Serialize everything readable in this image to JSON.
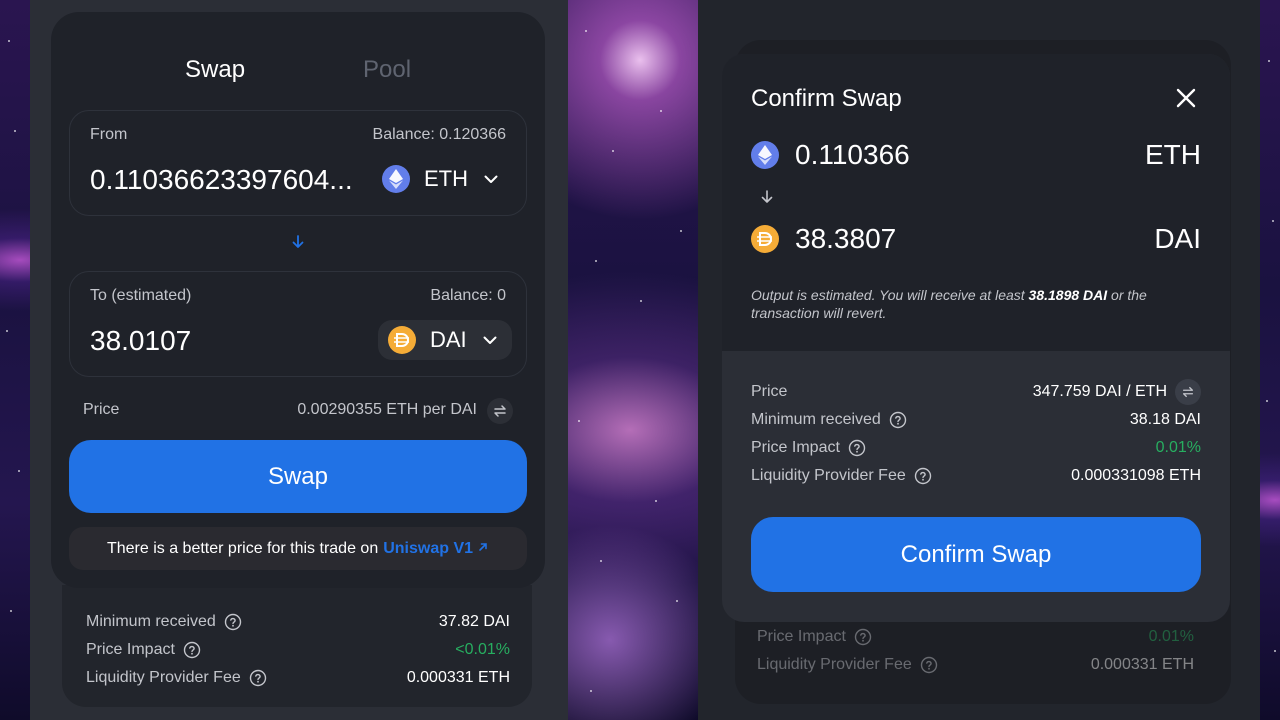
{
  "left": {
    "tabs": {
      "swap": "Swap",
      "pool": "Pool"
    },
    "from": {
      "label": "From",
      "balance": "Balance: 0.120366",
      "amount": "0.11036623397604...",
      "token": "ETH"
    },
    "to": {
      "label": "To (estimated)",
      "balance": "Balance: 0",
      "amount": "38.0107",
      "token": "DAI"
    },
    "price": {
      "label": "Price",
      "value": "0.00290355 ETH per DAI"
    },
    "swap_button": "Swap",
    "better_price": {
      "text": "There is a better price for this trade on",
      "link": "Uniswap V1"
    },
    "details": {
      "minimum_received": {
        "label": "Minimum received",
        "value": "37.82 DAI"
      },
      "price_impact": {
        "label": "Price Impact",
        "value": "<0.01%"
      },
      "lp_fee": {
        "label": "Liquidity Provider Fee",
        "value": "0.000331 ETH"
      }
    }
  },
  "right": {
    "title": "Confirm Swap",
    "from": {
      "amount": "0.110366",
      "token": "ETH"
    },
    "to": {
      "amount": "38.3807",
      "token": "DAI"
    },
    "note": {
      "before": "Output is estimated. You will receive at least ",
      "amount": "38.1898 DAI",
      "after": " or the transaction will revert."
    },
    "details": {
      "price": {
        "label": "Price",
        "value": "347.759 DAI / ETH"
      },
      "minimum_received": {
        "label": "Minimum received",
        "value": "38.18 DAI"
      },
      "price_impact": {
        "label": "Price Impact",
        "value": "0.01%"
      },
      "lp_fee": {
        "label": "Liquidity Provider Fee",
        "value": "0.000331098 ETH"
      }
    },
    "confirm_button": "Confirm Swap",
    "background_rows": {
      "price_impact": {
        "label": "Price Impact",
        "value": "0.01%"
      },
      "lp_fee": {
        "label": "Liquidity Provider Fee",
        "value": "0.000331 ETH"
      }
    }
  },
  "colors": {
    "accent": "#2172e5",
    "positive": "#27ae60",
    "eth": "#627eea",
    "dai": "#f5ac37"
  },
  "icons": {
    "eth": "ethereum-icon",
    "dai": "dai-icon",
    "chevron": "chevron-down-icon",
    "arrow": "arrow-down-icon",
    "flip": "swap-arrows-icon",
    "help": "question-circle-icon",
    "close": "close-icon",
    "external": "external-link-icon"
  }
}
